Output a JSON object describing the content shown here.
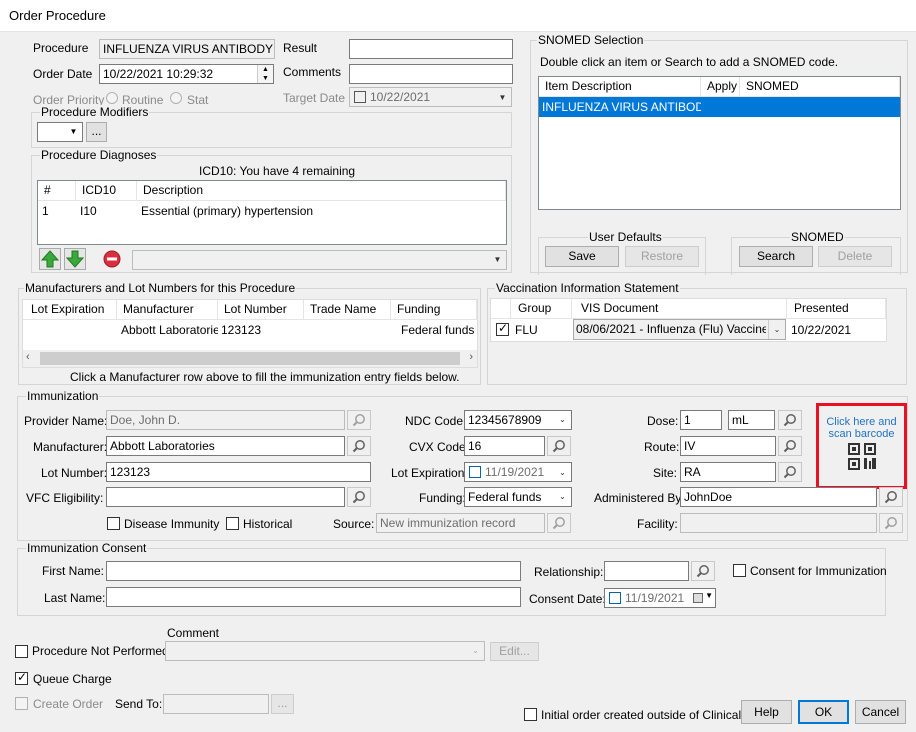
{
  "window": {
    "title": "Order Procedure"
  },
  "order": {
    "procedure_label": "Procedure",
    "procedure_value": "INFLUENZA VIRUS ANTIBODY",
    "result_label": "Result",
    "result_value": "",
    "order_date_label": "Order Date",
    "order_date_value": "10/22/2021 10:29:32",
    "comments_label": "Comments",
    "comments_value": "",
    "priority_label": "Order Priority",
    "priority_options": [
      "Routine",
      "Stat"
    ],
    "target_date_label": "Target Date",
    "target_date_value": "10/22/2021"
  },
  "modifiers": {
    "title": "Procedure Modifiers",
    "more_label": "..."
  },
  "diagnoses": {
    "title": "Procedure Diagnoses",
    "remaining": "ICD10: You have 4 remaining",
    "columns": [
      "#",
      "ICD10",
      "Description"
    ],
    "rows": [
      {
        "num": "1",
        "icd10": "I10",
        "description": "Essential (primary) hypertension"
      }
    ]
  },
  "snomed": {
    "title": "SNOMED Selection",
    "hint": "Double click an item or Search to add a SNOMED code.",
    "columns": [
      "Item Description",
      "Apply",
      "SNOMED"
    ],
    "rows": [
      {
        "item": "INFLUENZA VIRUS ANTIBODY",
        "apply": "",
        "snomed": ""
      }
    ],
    "user_defaults_label": "User Defaults",
    "save_label": "Save",
    "restore_label": "Restore",
    "snomed_label": "SNOMED",
    "search_label": "Search",
    "delete_label": "Delete"
  },
  "manufacturers": {
    "title": "Manufacturers and Lot Numbers for this Procedure",
    "columns": [
      "Lot Expiration",
      "Manufacturer",
      "Lot Number",
      "Trade Name",
      "Funding"
    ],
    "rows": [
      {
        "lot_expiration": "",
        "manufacturer": "Abbott Laboratories",
        "lot_number": "123123",
        "trade_name": "",
        "funding": "Federal funds"
      }
    ],
    "hint": "Click a Manufacturer row above to fill the immunization entry fields below."
  },
  "vis": {
    "title": "Vaccination Information Statement",
    "columns": [
      "Group",
      "VIS Document",
      "Presented"
    ],
    "rows": [
      {
        "group": "FLU",
        "document": "08/06/2021 - Influenza (Flu) Vaccine ...",
        "presented": "10/22/2021"
      }
    ]
  },
  "immunization": {
    "title": "Immunization",
    "provider_label": "Provider Name:",
    "provider_value": "Doe, John D.",
    "manufacturer_label": "Manufacturer:",
    "manufacturer_value": "Abbott Laboratories",
    "lot_label": "Lot Number:",
    "lot_value": "123123",
    "vfc_label": "VFC Eligibility:",
    "vfc_value": "",
    "disease_immunity_label": "Disease Immunity",
    "historical_label": "Historical",
    "ndc_label": "NDC Code:",
    "ndc_value": "12345678909",
    "cvx_label": "CVX Code:",
    "cvx_value": "16",
    "lot_exp_label": "Lot Expiration:",
    "lot_exp_value": "11/19/2021",
    "funding_label": "Funding:",
    "funding_value": "Federal funds",
    "source_label": "Source:",
    "source_value": "New immunization record",
    "dose_label": "Dose:",
    "dose_value": "1",
    "dose_unit": "mL",
    "route_label": "Route:",
    "route_value": "IV",
    "site_label": "Site:",
    "site_value": "RA",
    "administered_label": "Administered By:",
    "administered_value": "JohnDoe",
    "facility_label": "Facility:",
    "facility_value": "",
    "barcode_text": "Click here and scan barcode"
  },
  "consent": {
    "title": "Immunization Consent",
    "first_name_label": "First Name:",
    "first_name_value": "",
    "last_name_label": "Last Name:",
    "last_name_value": "",
    "relationship_label": "Relationship:",
    "relationship_value": "",
    "consent_checkbox_label": "Consent for Immunization",
    "consent_date_label": "Consent Date:",
    "consent_date_value": "11/19/2021"
  },
  "footer": {
    "comment_label": "Comment",
    "not_performed_label": "Procedure Not Performed",
    "edit_label": "Edit...",
    "queue_charge_label": "Queue Charge",
    "create_order_label": "Create Order",
    "send_to_label": "Send To:",
    "send_to_more": "...",
    "outside_label": "Initial order created outside of Clinical",
    "help_label": "Help",
    "ok_label": "OK",
    "cancel_label": "Cancel"
  },
  "colors": {
    "selection": "#0078d7",
    "highlight_box": "#e81123",
    "barcode_text": "#1e73c8",
    "arrow_green": "#3aa83a",
    "remove_red": "#d9303e"
  }
}
